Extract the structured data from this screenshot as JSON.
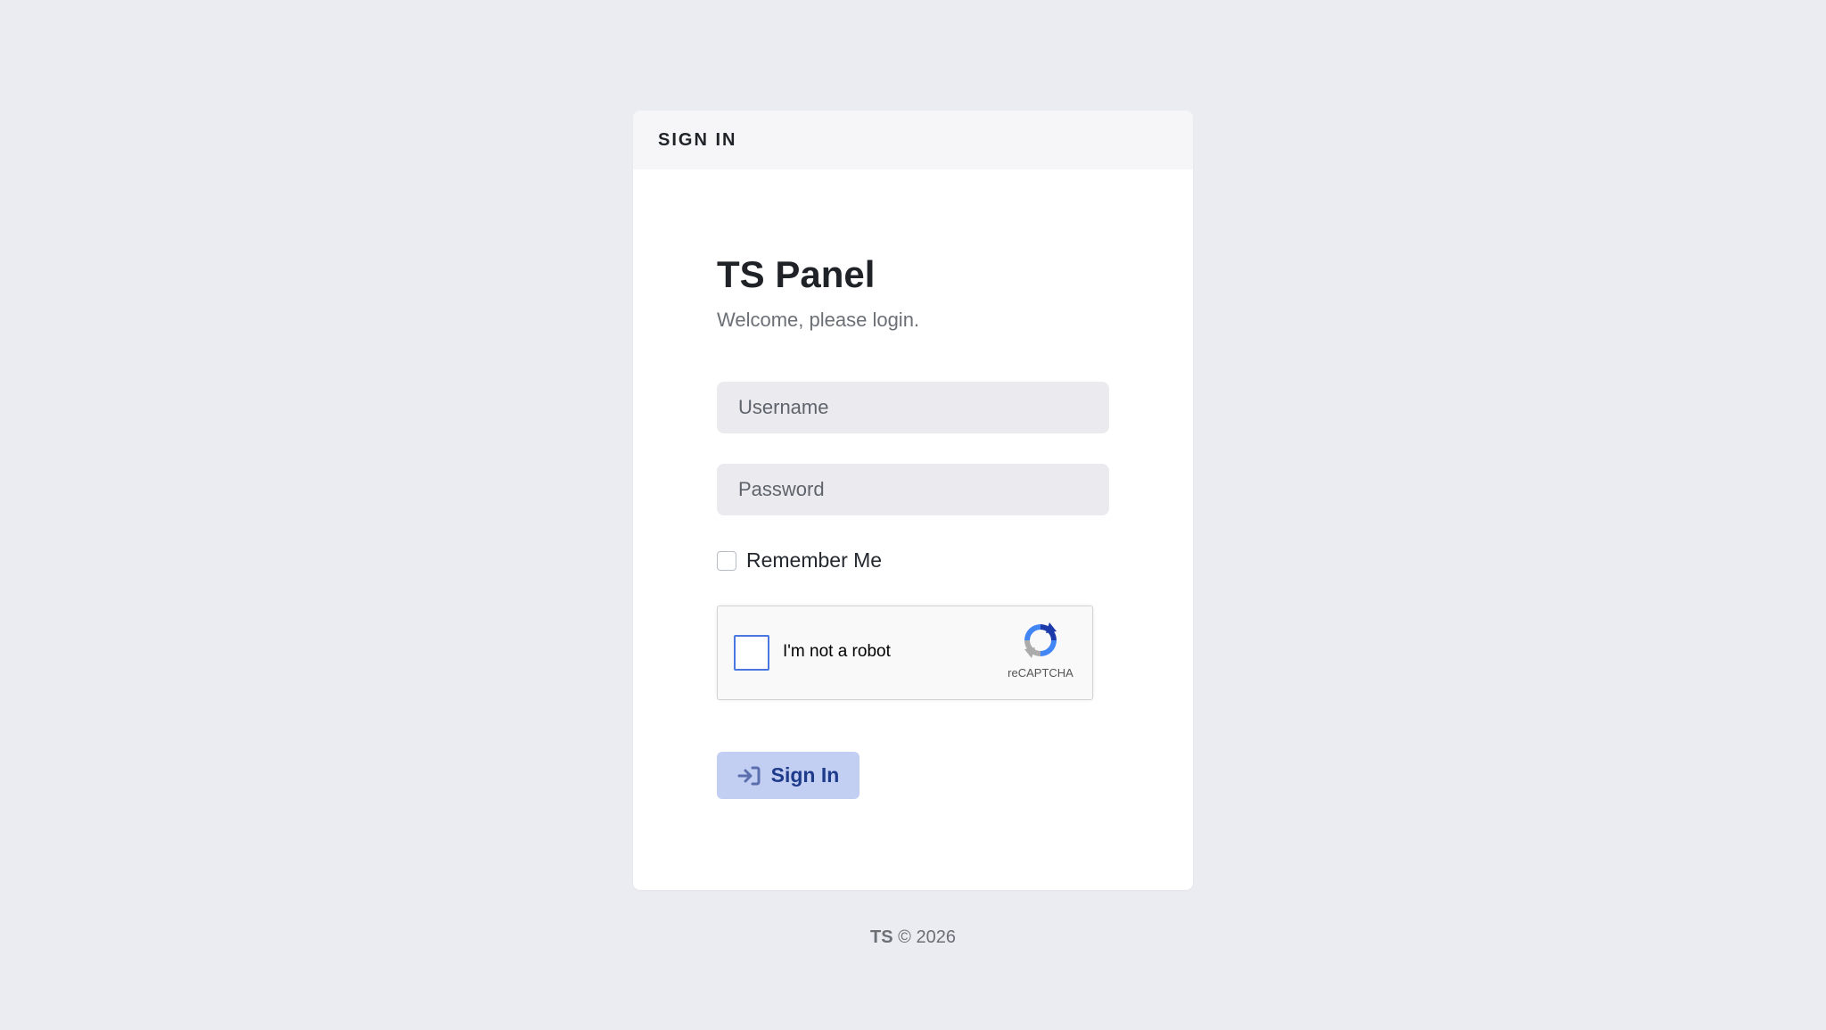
{
  "card": {
    "header_title": "SIGN IN",
    "brand_title": "TS Panel",
    "subtitle": "Welcome, please login."
  },
  "form": {
    "username_placeholder": "Username",
    "username_value": "",
    "password_placeholder": "Password",
    "password_value": "",
    "remember_label": "Remember Me",
    "remember_checked": false
  },
  "recaptcha": {
    "label": "I'm not a robot",
    "brand": "reCAPTCHA",
    "checked": false
  },
  "buttons": {
    "sign_in_label": "Sign In",
    "sign_in_icon": "sign-in-arrow-icon"
  },
  "footer": {
    "brand": "TS",
    "copyright": "© 2026"
  },
  "colors": {
    "page_bg": "#ebecf1",
    "button_bg": "#c3cef3",
    "button_text": "#1e3a8a",
    "recaptcha_check_border": "#4a78e0"
  }
}
